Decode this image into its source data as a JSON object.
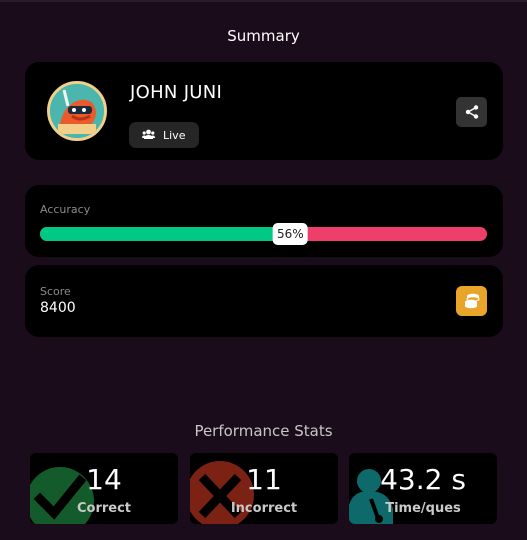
{
  "header": {
    "title": "Summary"
  },
  "player": {
    "name": "JOHN JUNI",
    "status": "Live",
    "avatar_icon": "ninja-avatar-icon",
    "share_icon": "share-icon"
  },
  "accuracy": {
    "label": "Accuracy",
    "percent": 56,
    "percent_text": "56%",
    "correct_color": "#00c985",
    "incorrect_color": "#ee3f6a"
  },
  "score": {
    "label": "Score",
    "value": "8400",
    "icon": "coins-icon",
    "icon_color": "#e8a52a"
  },
  "performance": {
    "title": "Performance Stats",
    "stats": [
      {
        "value": "14",
        "label": "Correct",
        "icon": "checkmark-icon",
        "color": "#1a7a3a"
      },
      {
        "value": "11",
        "label": "Incorrect",
        "icon": "cross-icon",
        "color": "#9a2a1a"
      },
      {
        "value": "43.2 s",
        "label": "Time/ques",
        "icon": "stopwatch-person-icon",
        "color": "#0e6a6a"
      }
    ]
  }
}
